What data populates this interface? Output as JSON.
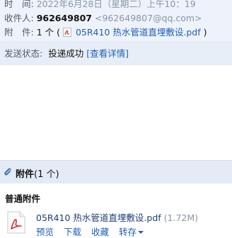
{
  "header": {
    "time_label": "时　间:",
    "time_value": "2022年6月28日（星期二）上午10：19",
    "to_label": "收件人:",
    "to_name": "962649807",
    "to_email": "<962649807@qq.com>",
    "att_label": "附　件:",
    "att_count": "1 个 (",
    "att_file": "05R410 热水管道直埋敷设.pdf",
    "att_close": ")"
  },
  "status": {
    "label": "发送状态:",
    "value": "投递成功",
    "detail_link": "[查看详情]"
  },
  "attachments": {
    "title": "附件",
    "count": "(1 个)",
    "section": "普通附件",
    "file": {
      "name": "05R410 热水管道直埋敷设.pdf",
      "size": "(1.72M)",
      "actions": [
        "预览",
        "下载",
        "收藏",
        "转存"
      ]
    }
  },
  "colors": {
    "header_bg": "#eef3fb",
    "status_bg": "#e7eef8",
    "attach_bar_bg": "#e3ebf7",
    "link": "#1f5fb8",
    "pdf_red": "#d62a2a"
  }
}
